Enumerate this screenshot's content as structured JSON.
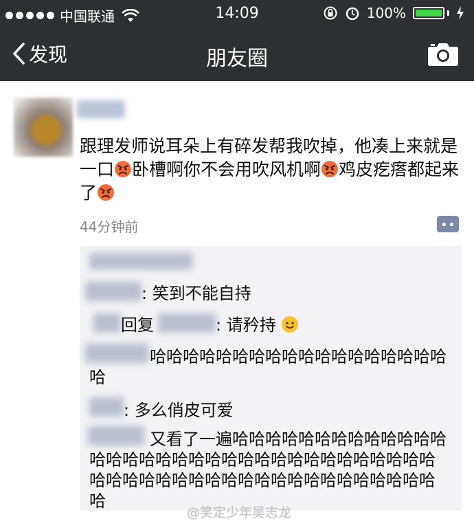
{
  "status_bar": {
    "carrier": "中国联通",
    "time": "14:09",
    "battery_percent": "100%",
    "battery_level": 1.0,
    "icons": [
      "signal-dots-icon",
      "wifi-icon",
      "rotation-lock-icon",
      "alarm-icon",
      "battery-icon",
      "charging-bolt-icon"
    ]
  },
  "nav": {
    "back_label": "发现",
    "title": "朋友圈",
    "icons": [
      "chevron-left-icon",
      "camera-icon"
    ]
  },
  "post": {
    "text_1": "跟理发师说耳朵上有碎发帮我吹掉，他凑上来就是一口",
    "text_2": "卧槽啊你不会用吹风机啊",
    "text_3": "鸡皮疙瘩都起来了",
    "timestamp": "44分钟前"
  },
  "comments": {
    "c1": ": 笑到不能自持",
    "c2_prefix": "回复",
    "c2_text": ": 请矜持",
    "c3": "哈哈哈哈哈哈哈哈哈哈哈哈哈哈哈哈哈哈哈",
    "c4": ": 多么俏皮可爱",
    "c5": "又看了一遍哈哈哈哈哈哈哈哈哈哈哈哈哈哈哈哈哈哈哈哈哈哈哈哈哈哈哈哈哈哈哈哈哈哈哈哈哈哈哈哈哈哈哈哈哈哈哈哈哈哈哈哈哈哈哈哈"
  },
  "watermark": "@笑定少年吴志龙",
  "colors": {
    "bar": "#2e2f33",
    "battery_fill": "#45d54a",
    "comment_bg": "#f3f3f5",
    "timestamp": "#8a8a8a"
  }
}
